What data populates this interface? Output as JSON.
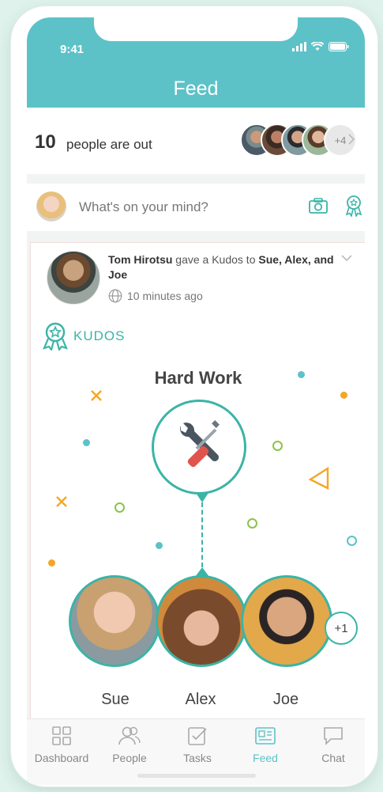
{
  "status": {
    "time": "9:41"
  },
  "header": {
    "title": "Feed"
  },
  "people_out": {
    "count": "10",
    "text": "people are out",
    "more": "+4"
  },
  "composer": {
    "placeholder": "What's on your mind?"
  },
  "post": {
    "author": "Tom Hirotsu",
    "action": " gave a Kudos to ",
    "recipients": "Sue, Alex, and Joe",
    "time": "10 minutes ago",
    "tag": "KUDOS",
    "kudos_title": "Hard Work",
    "recipient_names": [
      "Sue",
      "Alex",
      "Joe"
    ],
    "extra_recipients": "+1"
  },
  "tabs": [
    {
      "label": "Dashboard",
      "icon": "dashboard-icon"
    },
    {
      "label": "People",
      "icon": "people-icon"
    },
    {
      "label": "Tasks",
      "icon": "tasks-icon"
    },
    {
      "label": "Feed",
      "icon": "feed-icon"
    },
    {
      "label": "Chat",
      "icon": "chat-icon"
    }
  ],
  "colors": {
    "accent": "#5cc2c8",
    "kudos": "#3bb4a6",
    "deco_orange": "#f5a623",
    "deco_green": "#8bc34a"
  }
}
